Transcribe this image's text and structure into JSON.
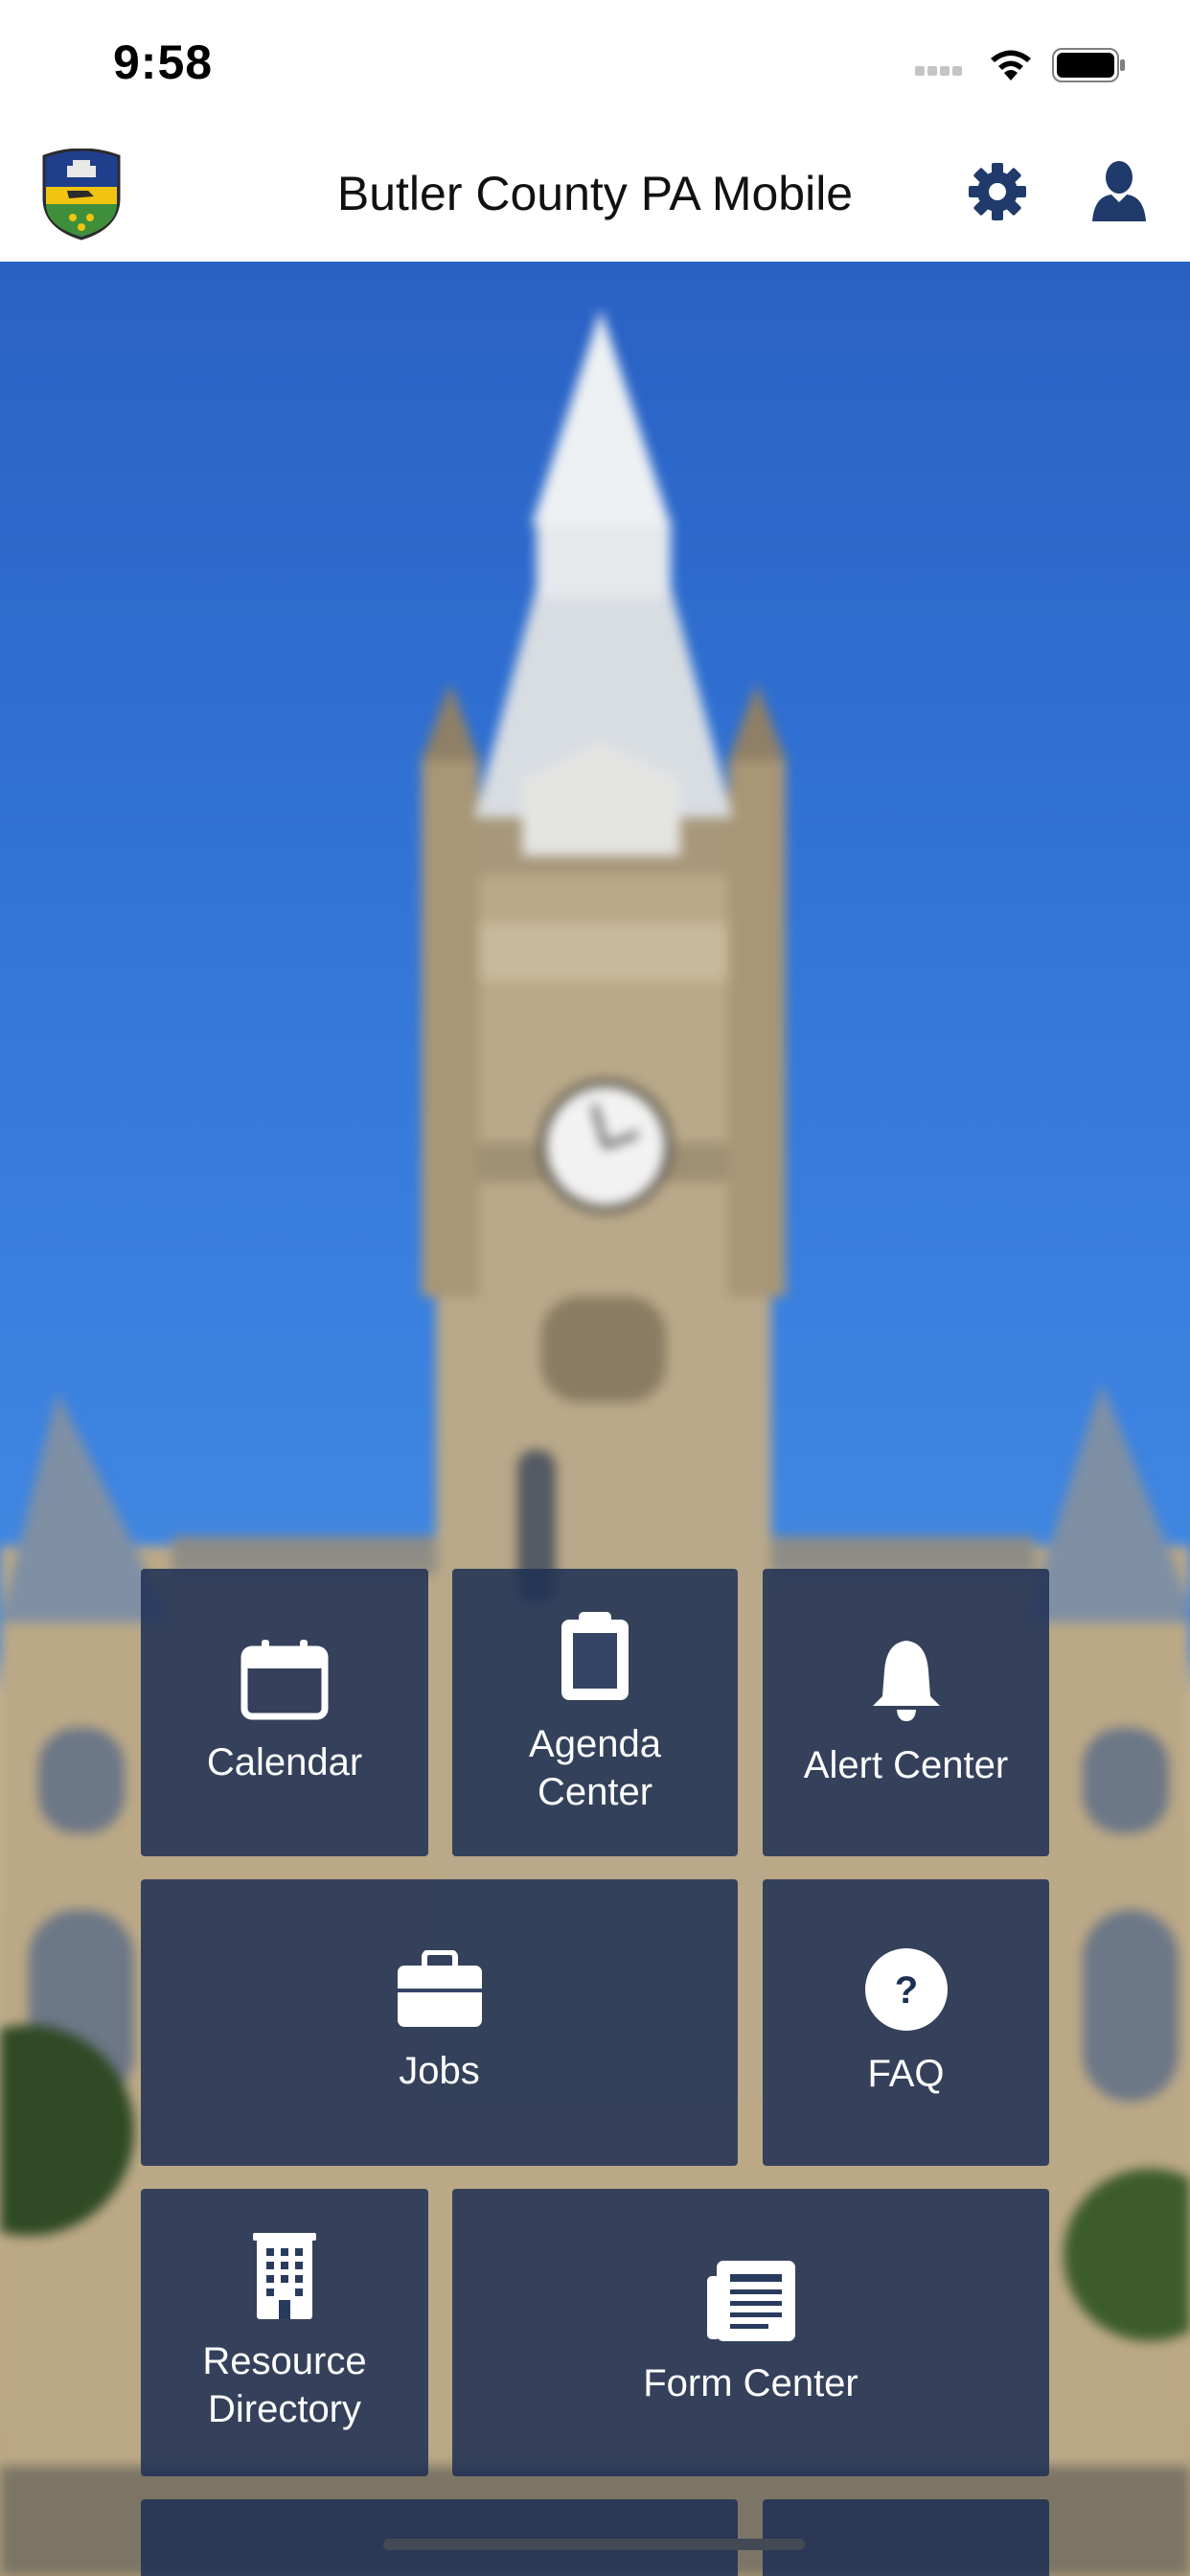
{
  "status_bar": {
    "time": "9:58"
  },
  "header": {
    "title": "Butler County PA Mobile"
  },
  "colors": {
    "tile_bg": "#1e3054",
    "icon_navy": "#1f3a6b",
    "sky": "#3173d5"
  },
  "tiles": [
    {
      "label": "Calendar",
      "icon": "calendar-icon"
    },
    {
      "label": "Agenda Center",
      "icon": "clipboard-icon"
    },
    {
      "label": "Alert Center",
      "icon": "bell-icon"
    },
    {
      "label": "Jobs",
      "icon": "briefcase-icon"
    },
    {
      "label": "FAQ",
      "icon": "question-icon"
    },
    {
      "label": "Resource Directory",
      "icon": "building-icon"
    },
    {
      "label": "Form Center",
      "icon": "form-icon"
    }
  ]
}
